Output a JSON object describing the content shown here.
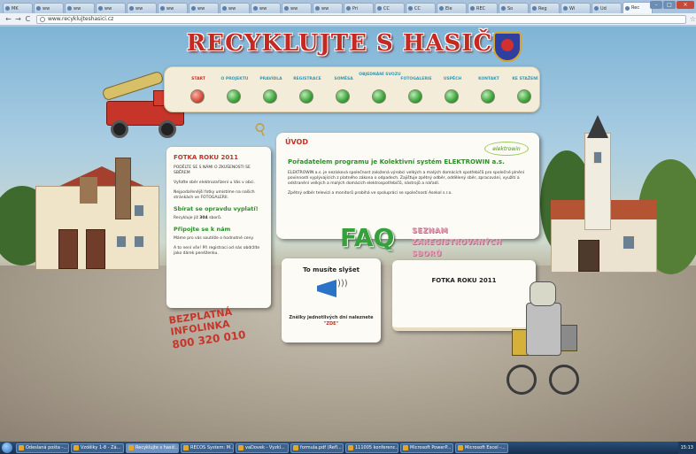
{
  "browser": {
    "tabs": [
      "MK",
      "ww",
      "ww",
      "ww",
      "ww",
      "ww",
      "ww",
      "ww",
      "ww",
      "ww",
      "ww",
      "Pri",
      "CC",
      "CC",
      "Ele",
      "REC",
      "So",
      "Reg",
      "Wi",
      "Ud",
      "Rec"
    ],
    "active_tab": 20,
    "url": "www.recyklujteshasici.cz"
  },
  "site": {
    "title": "RECYKLUJTE S HASIČI",
    "nav": [
      {
        "label": "START",
        "active": true
      },
      {
        "label": "O PROJEKTU",
        "active": false
      },
      {
        "label": "PRAVIDLA",
        "active": false
      },
      {
        "label": "REGISTRACE",
        "active": false
      },
      {
        "label": "SOMĚSA",
        "active": false
      },
      {
        "label": "OBJEDNÁNÍ SVOZU",
        "active": false
      },
      {
        "label": "FOTOGALERIE",
        "active": false
      },
      {
        "label": "USPĚCH",
        "active": false
      },
      {
        "label": "KONTAKT",
        "active": false
      },
      {
        "label": "KE STAŽENÍ",
        "active": false
      }
    ],
    "left_panel": {
      "title": "FOTKA ROKU 2011",
      "p1": "PODĚLTE SE S NÁMI O ZKUŠENOSTI SE SBĚREM",
      "p2": "Vyfoťte sběr elektrozařízení u Vás v obci.",
      "p3": "Nejpodařenější fotky umístíme na našich stránkách ve FOTOGALERII.",
      "sub1": "Sbírat se opravdu vyplatí!",
      "count_prefix": "Recykluje již",
      "count_value": "304",
      "count_suffix": "sborů.",
      "sub2": "Připojte se k nám",
      "p4": "Máme pro vás soutěže o hodnotné ceny.",
      "p5": "A to není vše! Při registraci od nás obdržíte jako dárek peněženku."
    },
    "infolinka": {
      "title": "BEZPLATNÁ INFOLINKA",
      "phone": "800 320 010"
    },
    "intro": {
      "heading": "ÚVOD",
      "logo": "elektrowin",
      "subheading": "Pořadatelem programu je Kolektivní systém ELEKTROWIN a.s.",
      "p1": "ELEKTROWIN a.s. je nezisková společnost založená výrobci velkých a malých domácích spotřebičů pro společné plnění povinností vyplývajících z platného zákona o odpadech. Zajišťuje zpětný odběr, oddělený sběr, zpracování, využití a odstranění velkých a malých domácích elektrospotřebičů, nástrojů a nářadí.",
      "p2": "Zpětný odběr televizí a monitorů probíhá ve spolupráci se společností Asekol s.r.o."
    },
    "faq": "FAQ",
    "seznam": "SEZNAM ZAREGISTROVANÝCH SBORŮ",
    "listen": {
      "title": "To musíte slyšet",
      "text": "Znělky jednotlivých dní naleznete",
      "link": "\"ZDE\""
    },
    "photo_box": {
      "title": "FOTKA ROKU 2011"
    }
  },
  "taskbar": {
    "items": [
      "Odeslaná pošta -...",
      "Vzdělky 1-8 - Zá...",
      "Recyklujte s hasič...",
      "RECOS System: M...",
      "vaDovek - Vyzkl...",
      "formula.pdf (Refl...",
      "111005 konferenc...",
      "Microsoft PowerP...",
      "Microsoft Excel -..."
    ],
    "active_item": 2,
    "clock": "15:13"
  }
}
